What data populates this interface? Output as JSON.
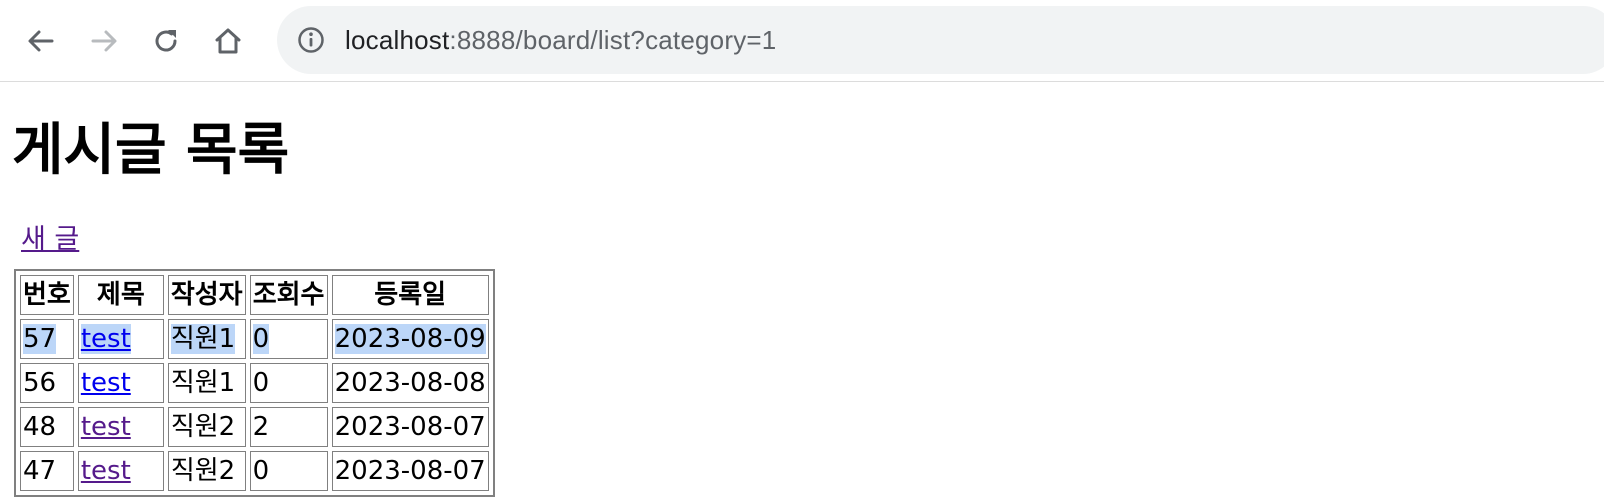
{
  "browser": {
    "url_host": "localhost",
    "url_rest": ":8888/board/list?category=1",
    "icons": [
      "back-icon",
      "forward-icon",
      "reload-icon",
      "home-icon",
      "info-icon"
    ]
  },
  "page": {
    "title": "게시글 목록",
    "new_link": "새 글"
  },
  "table": {
    "headers": [
      "번호",
      "제목",
      "작성자",
      "조회수",
      "등록일"
    ],
    "rows": [
      {
        "no": "57",
        "title": "test",
        "author": "직원1",
        "views": "0",
        "date": "2023-08-09"
      },
      {
        "no": "56",
        "title": "test",
        "author": "직원1",
        "views": "0",
        "date": "2023-08-08"
      },
      {
        "no": "48",
        "title": "test",
        "author": "직원2",
        "views": "2",
        "date": "2023-08-07"
      },
      {
        "no": "47",
        "title": "test",
        "author": "직원2",
        "views": "0",
        "date": "2023-08-07"
      }
    ]
  },
  "colors": {
    "link_unvisited": "#0000ee",
    "link_visited": "#551a8b",
    "selection": "#bcd6f8",
    "omnibox_bg": "#f1f3f4"
  }
}
